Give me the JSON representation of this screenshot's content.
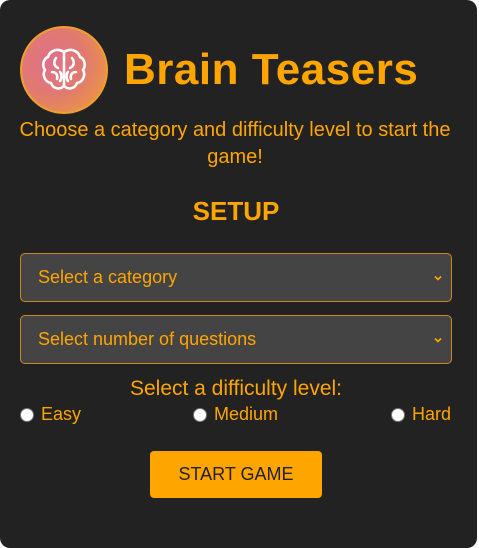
{
  "app": {
    "title": "Brain Teasers",
    "subtitle": "Choose a category and difficulty level to start the game!",
    "logo_icon": "brain-icon"
  },
  "setup": {
    "heading": "SETUP",
    "category_select": {
      "value": "Select a category"
    },
    "questions_select": {
      "value": "Select number of questions"
    },
    "difficulty": {
      "label": "Select a difficulty level:",
      "options": [
        "Easy",
        "Medium",
        "Hard"
      ]
    },
    "start_label": "START GAME"
  },
  "colors": {
    "background": "#222222",
    "accent": "#ffa500",
    "select_bg": "#444444"
  }
}
